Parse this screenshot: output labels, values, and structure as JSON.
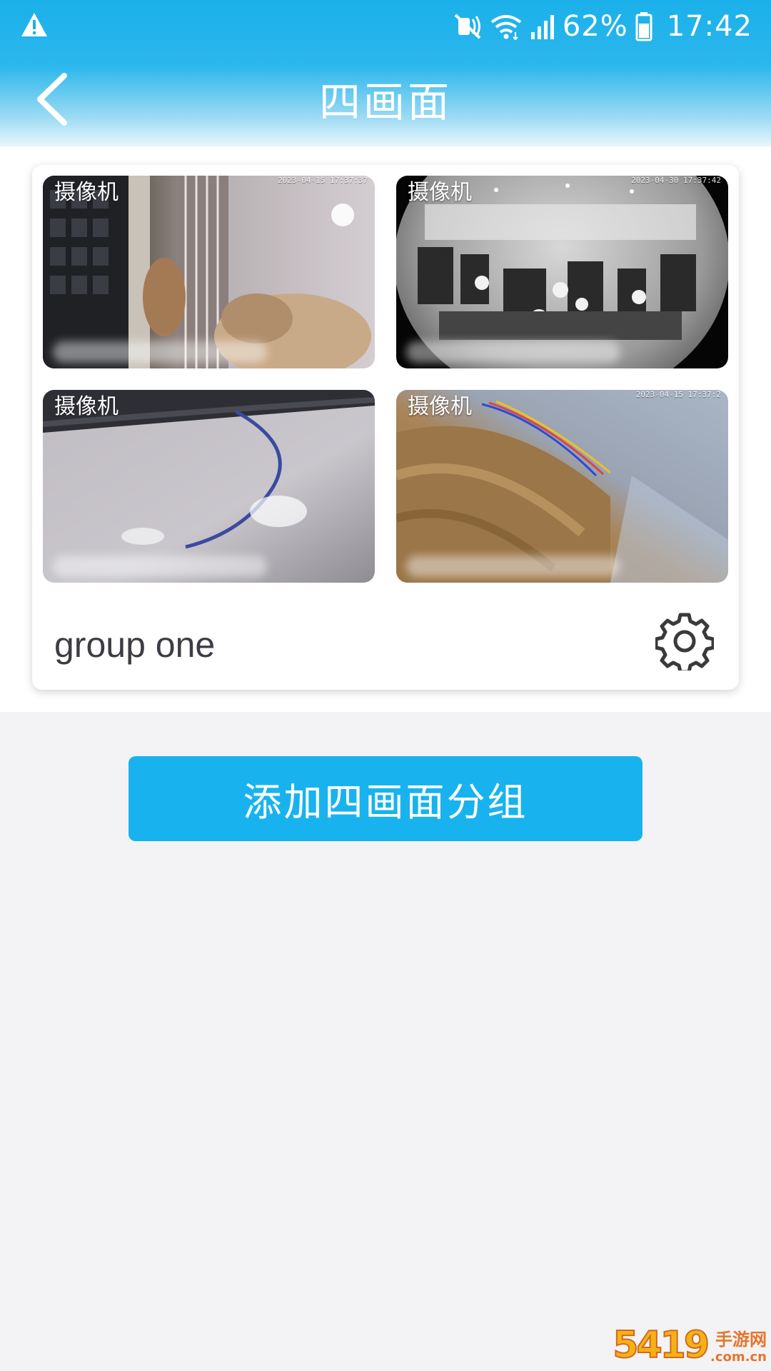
{
  "status_bar": {
    "battery_percent": "62%",
    "clock": "17:42",
    "icons": [
      "warning-icon",
      "mute-icon",
      "wifi-icon",
      "signal-icon",
      "battery-icon"
    ]
  },
  "header": {
    "title": "四画面",
    "back_icon": "chevron-left-icon"
  },
  "group": {
    "name": "group one",
    "settings_icon": "gear-icon",
    "tiles": [
      {
        "label": "摄像机",
        "stamp": "2023-04-15 17:37:37"
      },
      {
        "label": "摄像机",
        "stamp": "2023-04-30 17:37:42"
      },
      {
        "label": "摄像机",
        "stamp": ""
      },
      {
        "label": "摄像机",
        "stamp": "2023-04-15 17:37:2"
      }
    ]
  },
  "actions": {
    "add_group_label": "添加四画面分组"
  },
  "watermark": {
    "digits": "5419",
    "name": "手游网",
    "site": ".com.cn"
  },
  "colors": {
    "header_top": "#1bb0ea",
    "accent_button": "#18b3ee",
    "page_background": "#f3f3f5",
    "text_dark": "#3c3c44"
  }
}
